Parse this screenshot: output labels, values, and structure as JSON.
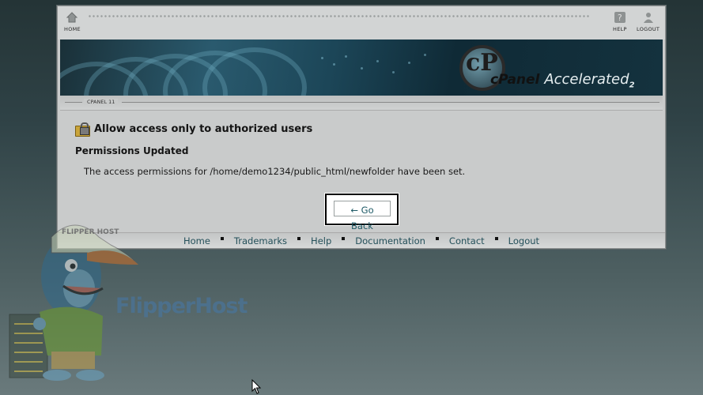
{
  "nav": {
    "home_label": "HOME",
    "help_label": "HELP",
    "logout_label": "LOGOUT"
  },
  "banner": {
    "logo_mark": "cP",
    "brand_word": "cPanel",
    "brand_tag": "Accelerated",
    "version_mark": "2"
  },
  "subbar": {
    "label": "CPANEL 11"
  },
  "main": {
    "title": "Allow access only to authorized users",
    "status_heading": "Permissions Updated",
    "message": "The access permissions for /home/demo1234/public_html/newfolder have been set."
  },
  "actions": {
    "go_back_label": "← Go Back"
  },
  "footer": {
    "links": [
      "Home",
      "Trademarks",
      "Help",
      "Documentation",
      "Contact",
      "Logout"
    ]
  },
  "branding": {
    "name": "FlipperHost",
    "hat_text": "FLIPPER HOST"
  },
  "colors": {
    "link": "#24505a",
    "button_text": "#1e5a66",
    "highlight_border": "#000000"
  },
  "icons": [
    "home-icon",
    "help-icon",
    "logout-icon",
    "lock-folder-icon",
    "cursor-icon"
  ]
}
